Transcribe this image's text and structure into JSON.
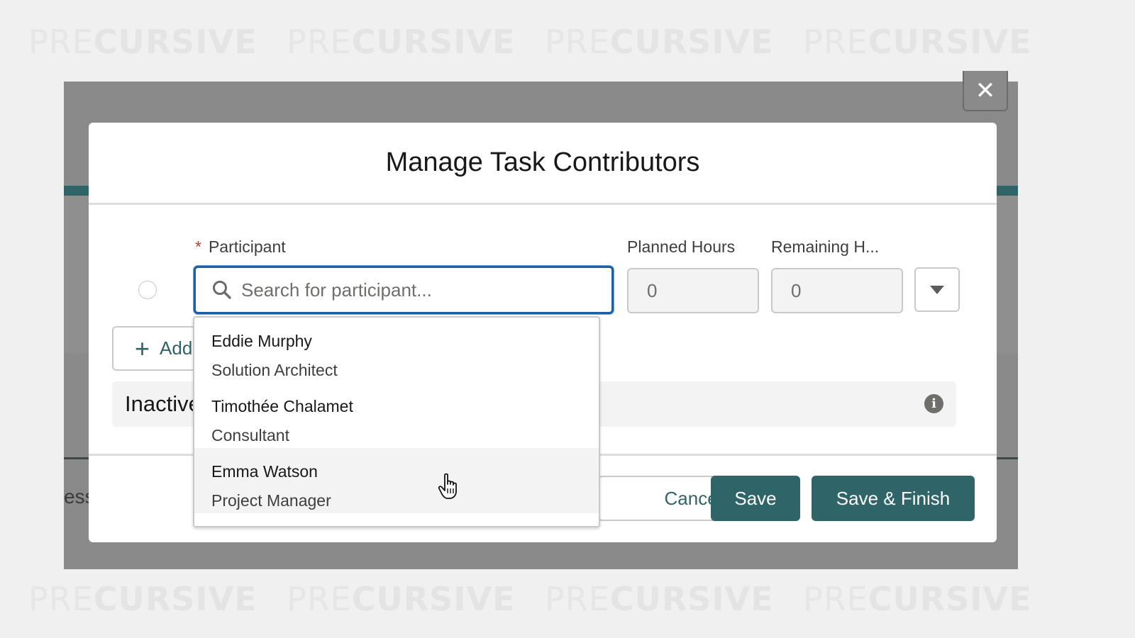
{
  "watermark": {
    "pre": "PRE",
    "cursive": "CURSIVE"
  },
  "background": {
    "partial_text": "ess"
  },
  "modal": {
    "title": "Manage Task Contributors",
    "close_icon": "close-icon",
    "fields": {
      "participant_label": "Participant",
      "required_marker": "*",
      "search_placeholder": "Search for participant...",
      "planned_hours_label": "Planned Hours",
      "planned_hours_value": "0",
      "remaining_hours_label": "Remaining H...",
      "remaining_hours_value": "0"
    },
    "add_button_label": "Add",
    "inactive_label": "Inactive",
    "footer": {
      "cancel": "Cancel",
      "save": "Save",
      "save_finish": "Save & Finish"
    }
  },
  "dropdown": {
    "items": [
      {
        "name": "Eddie Murphy",
        "role": "Solution Architect"
      },
      {
        "name": "Timothée Chalamet",
        "role": "Consultant"
      },
      {
        "name": "Emma Watson",
        "role": "Project Manager"
      }
    ],
    "hovered_index": 2
  },
  "colors": {
    "brand": "#2f6468",
    "focus": "#1b5fa8",
    "required": "#c23934",
    "overlay": "#8a8a8a"
  }
}
